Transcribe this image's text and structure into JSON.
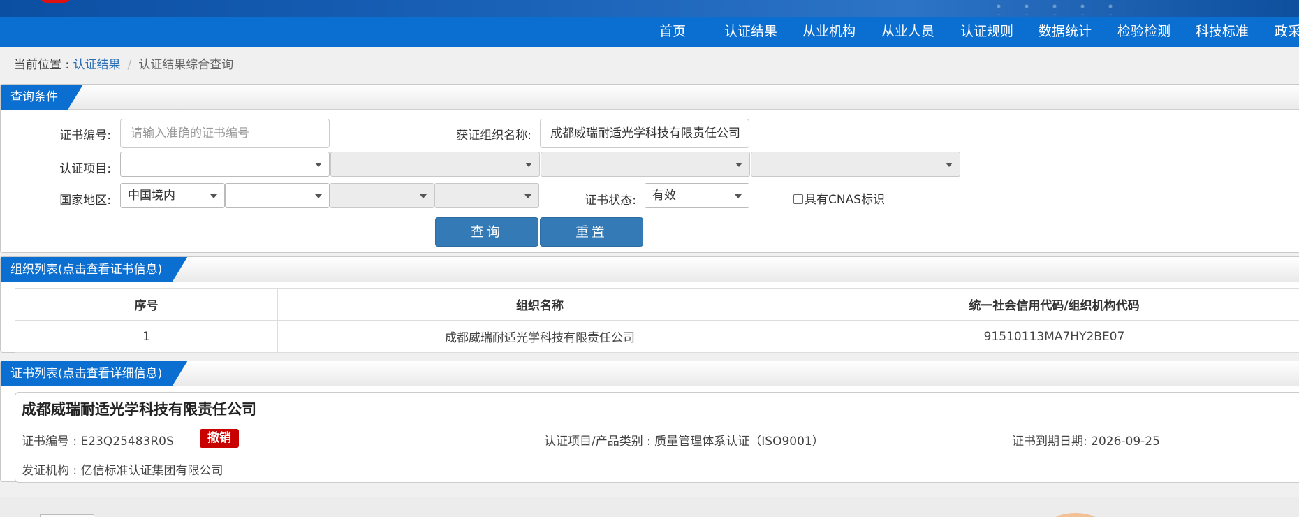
{
  "nav": {
    "items": [
      "首页",
      "认证结果",
      "从业机构",
      "从业人员",
      "认证规则",
      "数据统计",
      "检验检测",
      "科技标准",
      "政采"
    ]
  },
  "breadcrumb": {
    "prefix": "当前位置 : ",
    "link": "认证结果",
    "separator": "/",
    "current": "认证结果综合查询"
  },
  "query": {
    "tab": "查询条件",
    "cert_no_label": "证书编号:",
    "cert_no_placeholder": "请输入准确的证书编号",
    "org_label": "获证组织名称:",
    "org_value": "成都威瑞耐适光学科技有限责任公司",
    "project_label": "认证项目:",
    "region_label": "国家地区:",
    "region_value": "中国境内",
    "status_label": "证书状态:",
    "status_value": "有效",
    "cnas_label": "具有CNAS标识",
    "search_button": "查询",
    "reset_button": "重置"
  },
  "org_list": {
    "tab": "组织列表(点击查看证书信息)",
    "headers": [
      "序号",
      "组织名称",
      "统一社会信用代码/组织机构代码"
    ],
    "rows": [
      [
        "1",
        "成都威瑞耐适光学科技有限责任公司",
        "91510113MA7HY2BE07"
      ]
    ]
  },
  "cert_list": {
    "tab": "证书列表(点击查看详细信息)",
    "items": [
      {
        "org": "成都威瑞耐适光学科技有限责任公司",
        "cert_no": "证书编号 : E23Q25483R0S",
        "badge": "撤销",
        "project": "认证项目/产品类别 : 质量管理体系认证（ISO9001）",
        "expiry": "证书到期日期: 2026-09-25",
        "issuer": "发证机构 : 亿信标准认证集团有限公司"
      }
    ]
  },
  "colors": {
    "nav_bg": "#0b6fd1",
    "button": "#337ab7",
    "badge": "#c80000",
    "link": "#2a6fb8"
  }
}
